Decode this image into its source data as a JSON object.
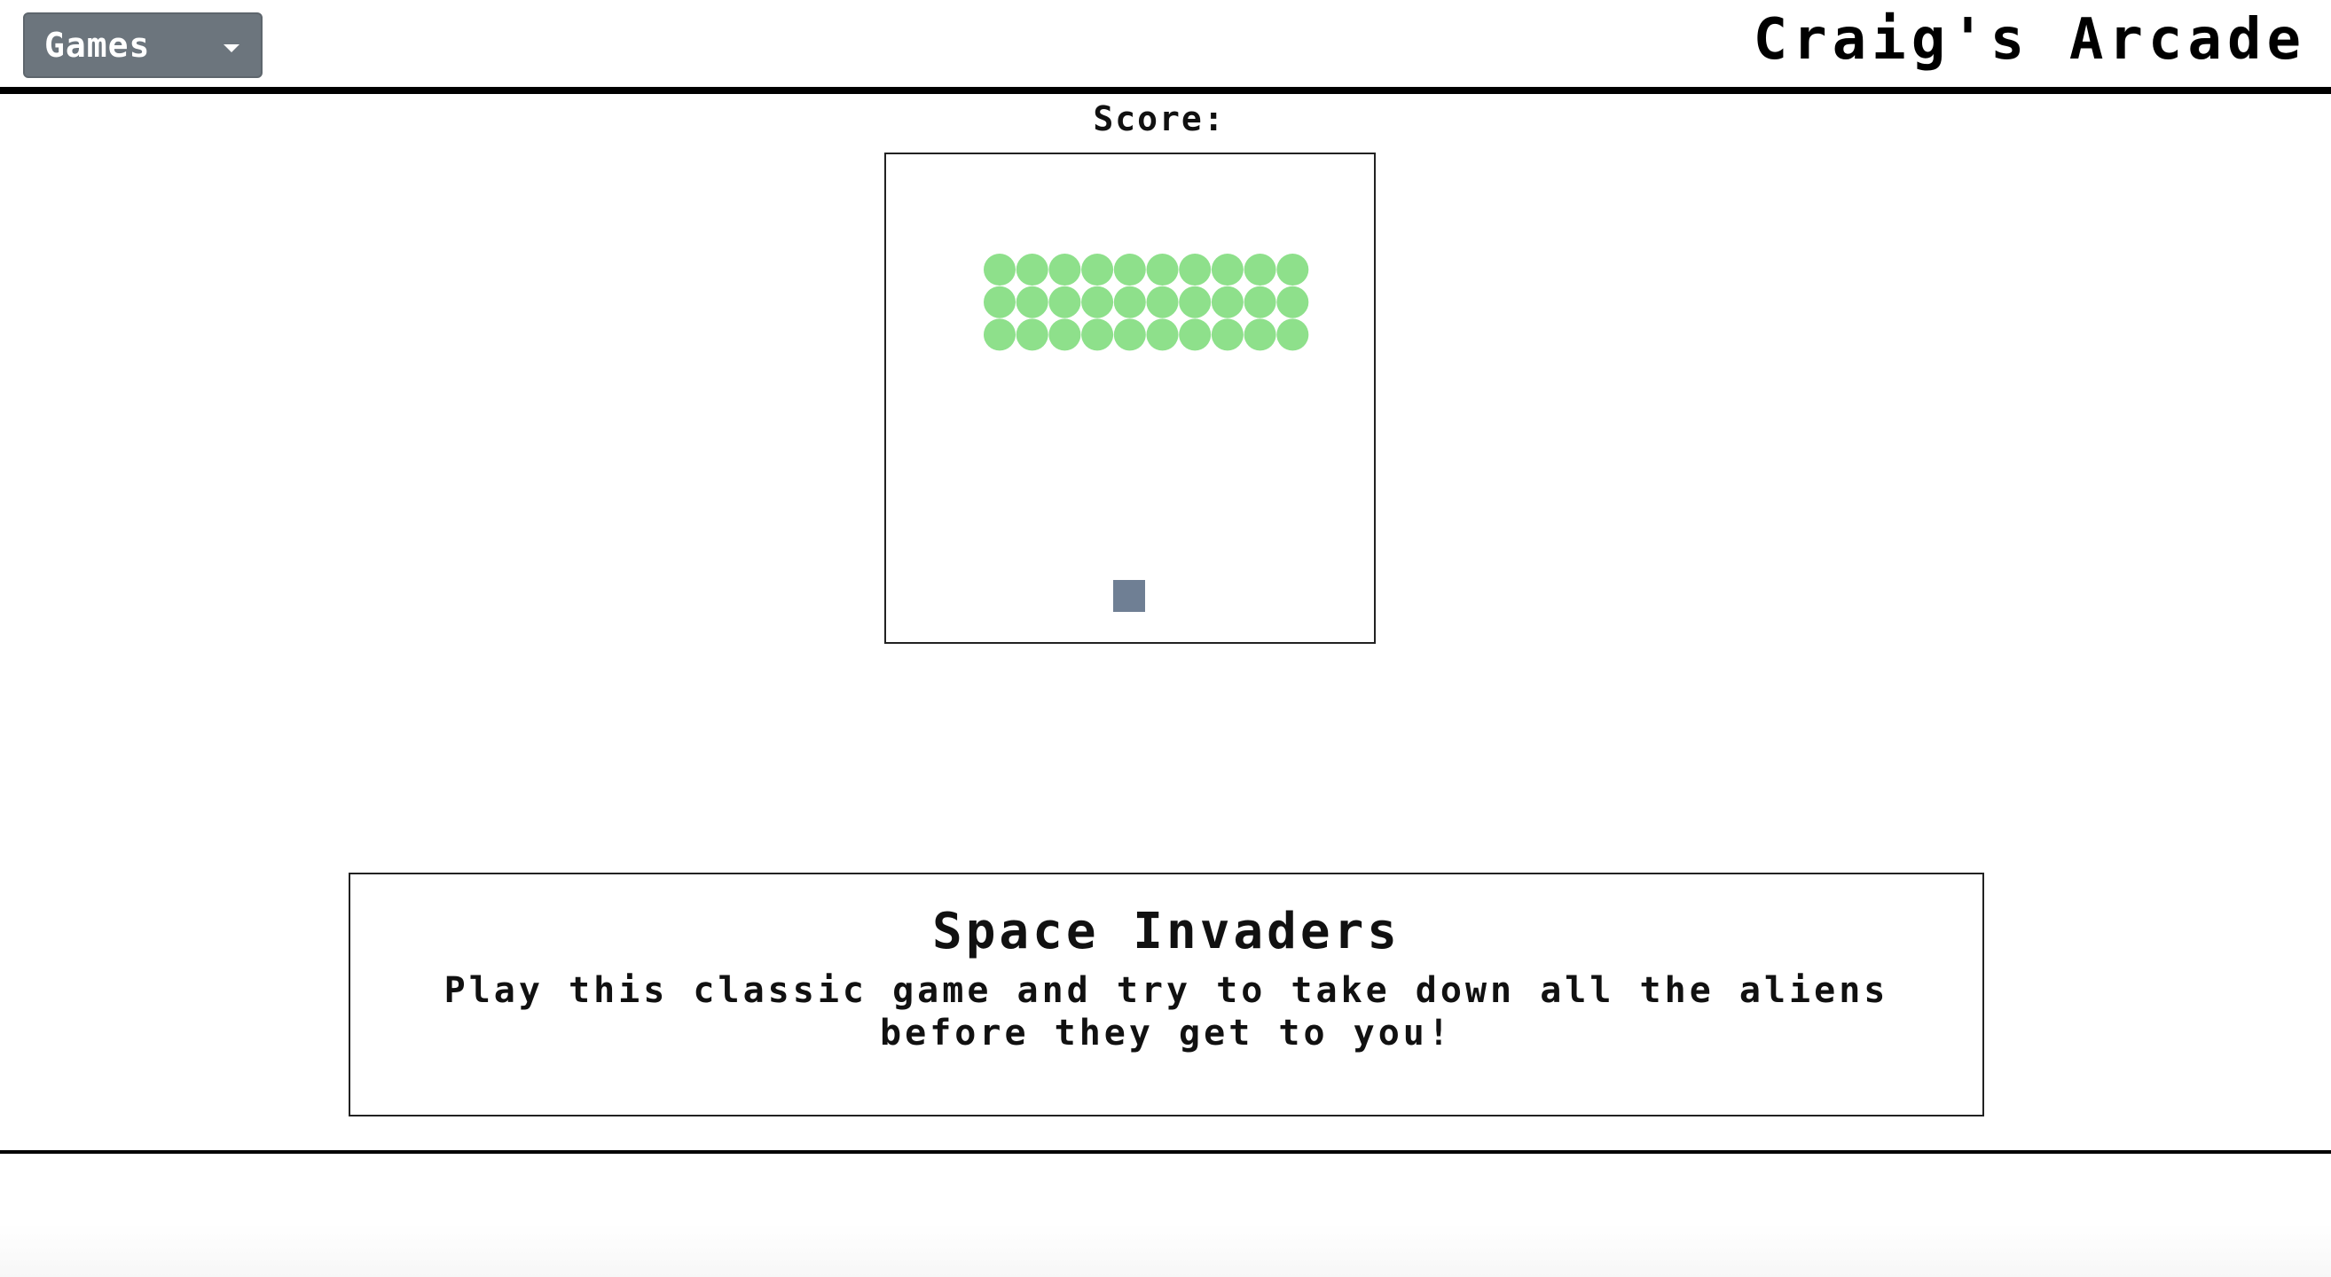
{
  "navbar": {
    "games_button_label": "Games",
    "site_title": "Craig's Arcade"
  },
  "game": {
    "score_label": "Score:",
    "alien_rows": 3,
    "alien_cols": 10,
    "alien_color": "#8ee08b",
    "player_color": "#6f7f94"
  },
  "info": {
    "title": "Space Invaders",
    "description": "Play this classic game and try to take down all the aliens before they get to you!"
  },
  "colors": {
    "button_bg": "#6c757d",
    "border": "#000000"
  }
}
